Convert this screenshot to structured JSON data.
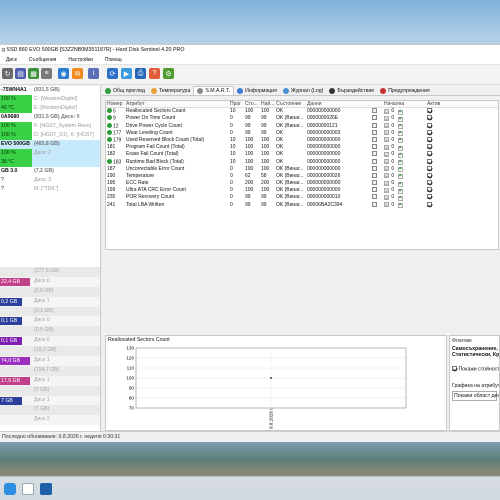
{
  "window": {
    "title": "g SSD 860 EVO 500GB [S3Z2NB0M351187R]  -  Hard Disk Sentinel 4.20 PRO"
  },
  "menu": [
    "Диск",
    "Съобщения",
    "Настройки",
    "Помощ"
  ],
  "disks": [
    {
      "a": "-75WN4A1",
      "b": "(931,5 GB)",
      "header": true
    },
    {
      "a": "100 %",
      "b": "C: [WesternDigitel]",
      "g": true
    },
    {
      "a": "40 °C",
      "b": "E: [WesternDigitel]",
      "g": true
    },
    {
      "a": "0A9680",
      "b": "(931,5 GB)  Диск: 0",
      "header": true
    },
    {
      "a": "100 %",
      "b": "F: [HGST_System Rese]",
      "g": true
    },
    {
      "a": "100 %",
      "b": "D: [HGST_D1], K: [HGST]",
      "g": true
    },
    {
      "a": " EVO 500GB",
      "b": "(465,8 GB)",
      "header": true,
      "sel": true
    },
    {
      "a": "100 %",
      "b": "Диск: 2",
      "g": true,
      "sel": true
    },
    {
      "a": "38 °C",
      "b": "",
      "g": true,
      "sel": true
    },
    {
      "a": "GB 3.0",
      "b": "(7,2 GB)",
      "header": true
    },
    {
      "a": "?",
      "b": "Диск: 3"
    },
    {
      "a": "?",
      "b": "M: [\"TDK\"]"
    }
  ],
  "volumes": [
    {
      "label": "",
      "right": "(277,5 GB)",
      "type": "plain"
    },
    {
      "label": "22,4 GB",
      "right": "Диск 0",
      "type": "bar",
      "color": "#c2408a",
      "w": 30
    },
    {
      "label": "",
      "right": "(0,6 GB)",
      "type": "plain"
    },
    {
      "label": "0,2 GB",
      "right": "Диск 1",
      "type": "bar",
      "color": "#2b3f9c",
      "w": 22
    },
    {
      "label": "",
      "right": "(0,1 GB)",
      "type": "plain"
    },
    {
      "label": "0,1 GB",
      "right": "Диск 0",
      "type": "bar",
      "color": "#2b3f9c",
      "w": 22
    },
    {
      "label": "",
      "right": "(0,5 GB)",
      "type": "plain"
    },
    {
      "label": "0,1 GB",
      "right": "Диск 0",
      "type": "bar",
      "color": "#7f1eb0",
      "w": 22
    },
    {
      "label": "",
      "right": "(10,2 GB)",
      "type": "plain"
    },
    {
      "label": "74,0 GB",
      "right": "Диск 1",
      "type": "bar",
      "color": "#9b2fc0",
      "w": 30
    },
    {
      "label": "",
      "right": "(194,7 GB)",
      "type": "plain"
    },
    {
      "label": "17,6 GB",
      "right": "Диск 1",
      "type": "bar",
      "color": "#c2408a",
      "w": 30
    },
    {
      "label": "",
      "right": "(7 GB)",
      "type": "plain"
    },
    {
      "label": "7 GB",
      "right": "Диск 1",
      "type": "bar",
      "color": "#2b3f9c",
      "w": 22
    },
    {
      "label": "",
      "right": "(7 GB)",
      "type": "plain"
    },
    {
      "label": "",
      "right": "Диск 2",
      "type": "plain"
    }
  ],
  "tabs": [
    {
      "label": "Общ преглед",
      "icon": "#2e9b3a"
    },
    {
      "label": "Температура",
      "icon": "#e6a23c"
    },
    {
      "label": "S.M.A.R.T.",
      "icon": "#888888",
      "active": true
    },
    {
      "label": "Информация",
      "icon": "#3a7bd5"
    },
    {
      "label": "Журнал (Log)",
      "icon": "#4a90d9"
    },
    {
      "label": "Бързодействие",
      "icon": "#333333"
    },
    {
      "label": "Предупреждения",
      "icon": "#c23030"
    }
  ],
  "smart_headers": [
    "Номер",
    "Атрибут",
    "Праг",
    "Сто...",
    "Най...",
    "Състояние",
    "Данни",
    "",
    "Начална",
    "",
    "Актив..."
  ],
  "smart_rows": [
    {
      "num": "5",
      "attr": "Reallocated Sectors Count",
      "thr": "10",
      "val": "100",
      "wor": "100",
      "st": "OK",
      "data": "000000000000",
      "ok": true
    },
    {
      "num": "9",
      "attr": "Power On Time Count",
      "thr": "0",
      "val": "99",
      "wor": "99",
      "st": "OK (Винаг...",
      "data": "0000000026E",
      "ok": true
    },
    {
      "num": "12",
      "attr": "Drive Power Cycle Count",
      "thr": "0",
      "val": "99",
      "wor": "99",
      "st": "OK (Винаг...",
      "data": "00000000121",
      "ok": true
    },
    {
      "num": "177",
      "attr": "Wear Leveling Count",
      "thr": "0",
      "val": "99",
      "wor": "99",
      "st": "OK",
      "data": "000000000003",
      "ok": true
    },
    {
      "num": "179",
      "attr": "Used Reserved Block Count (Total)",
      "thr": "10",
      "val": "100",
      "wor": "100",
      "st": "OK",
      "data": "000000000000",
      "ok": true
    },
    {
      "num": "181",
      "attr": "Program Fail Count (Total)",
      "thr": "10",
      "val": "100",
      "wor": "100",
      "st": "OK",
      "data": "000000000000",
      "ok": false
    },
    {
      "num": "182",
      "attr": "Erase Fail Count (Total)",
      "thr": "10",
      "val": "100",
      "wor": "100",
      "st": "OK",
      "data": "000000000000",
      "ok": false
    },
    {
      "num": "183",
      "attr": "Runtime Bad Block (Total)",
      "thr": "10",
      "val": "100",
      "wor": "100",
      "st": "OK",
      "data": "000000000000",
      "ok": true
    },
    {
      "num": "187",
      "attr": "Uncorrectable Error Count",
      "thr": "0",
      "val": "100",
      "wor": "100",
      "st": "OK (Винаг...",
      "data": "000000000000",
      "ok": false
    },
    {
      "num": "190",
      "attr": "Temperature",
      "thr": "0",
      "val": "62",
      "wor": "58",
      "st": "OK (Винаг...",
      "data": "000000000026",
      "ok": false
    },
    {
      "num": "195",
      "attr": "ECC Rate",
      "thr": "0",
      "val": "200",
      "wor": "200",
      "st": "OK (Винаг...",
      "data": "000000000000",
      "ok": false
    },
    {
      "num": "199",
      "attr": "Ultra ATA CRC Error Count",
      "thr": "0",
      "val": "100",
      "wor": "100",
      "st": "OK (Винаг...",
      "data": "000000000000",
      "ok": false
    },
    {
      "num": "235",
      "attr": "POR Recovery Count",
      "thr": "0",
      "val": "99",
      "wor": "99",
      "st": "OK (Винаг...",
      "data": "000000000010",
      "ok": false
    },
    {
      "num": "241",
      "attr": "Total LBA Written",
      "thr": "0",
      "val": "99",
      "wor": "99",
      "st": "OK (Винаг...",
      "data": "00006BA2C394",
      "ok": false
    }
  ],
  "chart": {
    "title": "Reallocated Sectors Count",
    "y_ticks": [
      "130",
      "120",
      "110",
      "100",
      "90",
      "80",
      "70"
    ],
    "x_label": "9.8.2026 г.",
    "point_value": 100
  },
  "flags": {
    "title": "Флагове",
    "lines": [
      "Самосъхранение, Б",
      "Статистически, Кри"
    ],
    "checkbox_label": "Покажи стойност",
    "graph_label": "Графика на атрибут",
    "graph_select": "Покажи област ден"
  },
  "status": {
    "text": "Последно обновяване: 9.8.2026 г. неделя 0:30:31"
  },
  "colors": {
    "ok_green": "#3ad146",
    "selection": "#c6e9fb"
  }
}
